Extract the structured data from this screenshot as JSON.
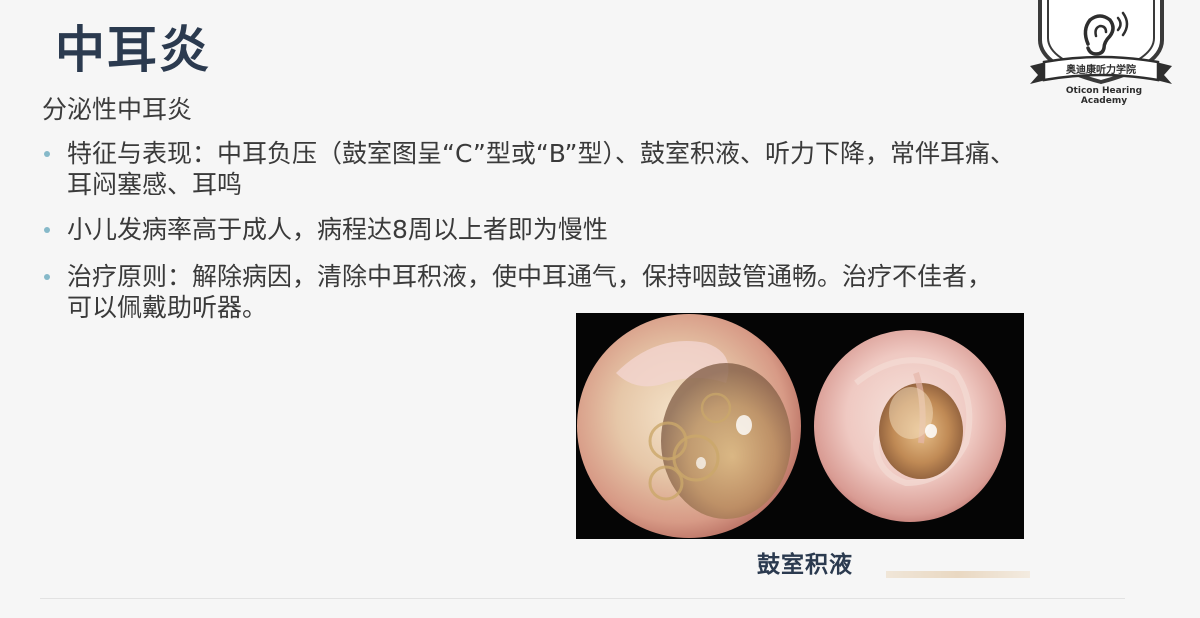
{
  "slide": {
    "title": "中耳炎",
    "subtitle": "分泌性中耳炎",
    "bullets": [
      {
        "line1": "特征与表现：中耳负压（鼓室图呈“C”型或“B”型）、鼓室积液、听力下降，常伴耳痛、",
        "line2": "耳闷塞感、耳鸣"
      },
      {
        "line1": "小儿发病率高于成人，病程达8周以上者即为慢性"
      },
      {
        "line1": "治疗原则：解除病因，清除中耳积液，使中耳通气，保持咽鼓管通畅。治疗不佳者，",
        "line2": "可以佩戴助听器。"
      }
    ],
    "image_caption": "鼓室积液"
  },
  "logo": {
    "banner_text": "奥迪康听力学院",
    "text_line1": "Oticon Hearing",
    "text_line2": "Academy",
    "icon": "ear-icon"
  },
  "colors": {
    "title": "#2b3a4f",
    "bullet_dot": "#86b9c9",
    "background": "#f6f6f6"
  }
}
